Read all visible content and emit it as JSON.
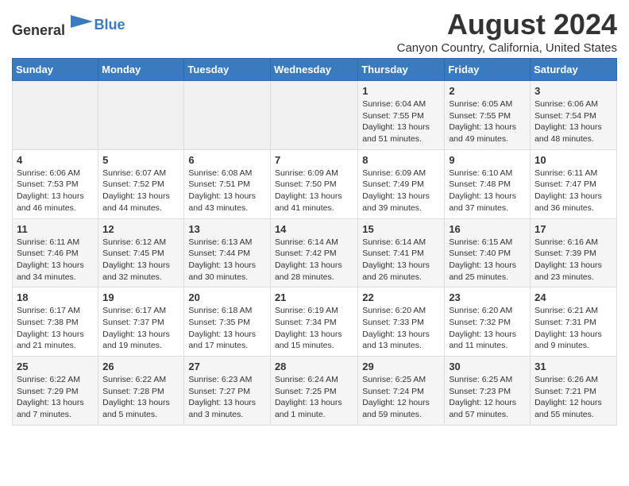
{
  "header": {
    "logo_general": "General",
    "logo_blue": "Blue",
    "month_year": "August 2024",
    "location": "Canyon Country, California, United States"
  },
  "days_of_week": [
    "Sunday",
    "Monday",
    "Tuesday",
    "Wednesday",
    "Thursday",
    "Friday",
    "Saturday"
  ],
  "weeks": [
    [
      {
        "day": "",
        "info": ""
      },
      {
        "day": "",
        "info": ""
      },
      {
        "day": "",
        "info": ""
      },
      {
        "day": "",
        "info": ""
      },
      {
        "day": "1",
        "info": "Sunrise: 6:04 AM\nSunset: 7:55 PM\nDaylight: 13 hours\nand 51 minutes."
      },
      {
        "day": "2",
        "info": "Sunrise: 6:05 AM\nSunset: 7:55 PM\nDaylight: 13 hours\nand 49 minutes."
      },
      {
        "day": "3",
        "info": "Sunrise: 6:06 AM\nSunset: 7:54 PM\nDaylight: 13 hours\nand 48 minutes."
      }
    ],
    [
      {
        "day": "4",
        "info": "Sunrise: 6:06 AM\nSunset: 7:53 PM\nDaylight: 13 hours\nand 46 minutes."
      },
      {
        "day": "5",
        "info": "Sunrise: 6:07 AM\nSunset: 7:52 PM\nDaylight: 13 hours\nand 44 minutes."
      },
      {
        "day": "6",
        "info": "Sunrise: 6:08 AM\nSunset: 7:51 PM\nDaylight: 13 hours\nand 43 minutes."
      },
      {
        "day": "7",
        "info": "Sunrise: 6:09 AM\nSunset: 7:50 PM\nDaylight: 13 hours\nand 41 minutes."
      },
      {
        "day": "8",
        "info": "Sunrise: 6:09 AM\nSunset: 7:49 PM\nDaylight: 13 hours\nand 39 minutes."
      },
      {
        "day": "9",
        "info": "Sunrise: 6:10 AM\nSunset: 7:48 PM\nDaylight: 13 hours\nand 37 minutes."
      },
      {
        "day": "10",
        "info": "Sunrise: 6:11 AM\nSunset: 7:47 PM\nDaylight: 13 hours\nand 36 minutes."
      }
    ],
    [
      {
        "day": "11",
        "info": "Sunrise: 6:11 AM\nSunset: 7:46 PM\nDaylight: 13 hours\nand 34 minutes."
      },
      {
        "day": "12",
        "info": "Sunrise: 6:12 AM\nSunset: 7:45 PM\nDaylight: 13 hours\nand 32 minutes."
      },
      {
        "day": "13",
        "info": "Sunrise: 6:13 AM\nSunset: 7:44 PM\nDaylight: 13 hours\nand 30 minutes."
      },
      {
        "day": "14",
        "info": "Sunrise: 6:14 AM\nSunset: 7:42 PM\nDaylight: 13 hours\nand 28 minutes."
      },
      {
        "day": "15",
        "info": "Sunrise: 6:14 AM\nSunset: 7:41 PM\nDaylight: 13 hours\nand 26 minutes."
      },
      {
        "day": "16",
        "info": "Sunrise: 6:15 AM\nSunset: 7:40 PM\nDaylight: 13 hours\nand 25 minutes."
      },
      {
        "day": "17",
        "info": "Sunrise: 6:16 AM\nSunset: 7:39 PM\nDaylight: 13 hours\nand 23 minutes."
      }
    ],
    [
      {
        "day": "18",
        "info": "Sunrise: 6:17 AM\nSunset: 7:38 PM\nDaylight: 13 hours\nand 21 minutes."
      },
      {
        "day": "19",
        "info": "Sunrise: 6:17 AM\nSunset: 7:37 PM\nDaylight: 13 hours\nand 19 minutes."
      },
      {
        "day": "20",
        "info": "Sunrise: 6:18 AM\nSunset: 7:35 PM\nDaylight: 13 hours\nand 17 minutes."
      },
      {
        "day": "21",
        "info": "Sunrise: 6:19 AM\nSunset: 7:34 PM\nDaylight: 13 hours\nand 15 minutes."
      },
      {
        "day": "22",
        "info": "Sunrise: 6:20 AM\nSunset: 7:33 PM\nDaylight: 13 hours\nand 13 minutes."
      },
      {
        "day": "23",
        "info": "Sunrise: 6:20 AM\nSunset: 7:32 PM\nDaylight: 13 hours\nand 11 minutes."
      },
      {
        "day": "24",
        "info": "Sunrise: 6:21 AM\nSunset: 7:31 PM\nDaylight: 13 hours\nand 9 minutes."
      }
    ],
    [
      {
        "day": "25",
        "info": "Sunrise: 6:22 AM\nSunset: 7:29 PM\nDaylight: 13 hours\nand 7 minutes."
      },
      {
        "day": "26",
        "info": "Sunrise: 6:22 AM\nSunset: 7:28 PM\nDaylight: 13 hours\nand 5 minutes."
      },
      {
        "day": "27",
        "info": "Sunrise: 6:23 AM\nSunset: 7:27 PM\nDaylight: 13 hours\nand 3 minutes."
      },
      {
        "day": "28",
        "info": "Sunrise: 6:24 AM\nSunset: 7:25 PM\nDaylight: 13 hours\nand 1 minute."
      },
      {
        "day": "29",
        "info": "Sunrise: 6:25 AM\nSunset: 7:24 PM\nDaylight: 12 hours\nand 59 minutes."
      },
      {
        "day": "30",
        "info": "Sunrise: 6:25 AM\nSunset: 7:23 PM\nDaylight: 12 hours\nand 57 minutes."
      },
      {
        "day": "31",
        "info": "Sunrise: 6:26 AM\nSunset: 7:21 PM\nDaylight: 12 hours\nand 55 minutes."
      }
    ]
  ]
}
